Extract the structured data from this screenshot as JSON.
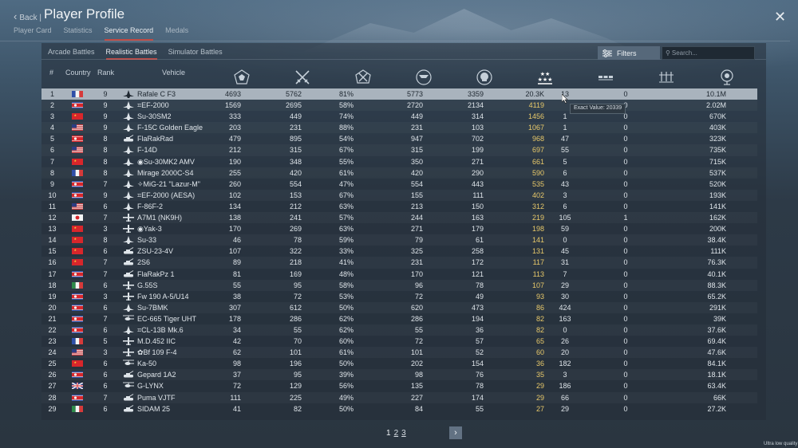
{
  "header": {
    "back_label": "Back",
    "title": "Player Profile",
    "tabs": [
      {
        "label": "Player Card",
        "active": false
      },
      {
        "label": "Statistics",
        "active": false
      },
      {
        "label": "Service Record",
        "active": true
      },
      {
        "label": "Medals",
        "active": false
      }
    ]
  },
  "subtabs": [
    {
      "label": "Arcade Battles",
      "active": false
    },
    {
      "label": "Realistic Battles",
      "active": true
    },
    {
      "label": "Simulator Battles",
      "active": false
    }
  ],
  "filters_label": "Filters",
  "search_placeholder": "Search...",
  "columns": {
    "num": "#",
    "country": "Country",
    "rank": "Rank",
    "vehicle": "Vehicle"
  },
  "stat_icons": [
    "battles-icon",
    "respawns-icon",
    "victories-icon",
    "missions-icon",
    "deaths-icon",
    "rank-stars-icon",
    "ground-kills-icon",
    "air-kills-icon",
    "score-icon"
  ],
  "colors": {
    "selected_row": "#a9b3bd",
    "highlight_value": "#e8c96a",
    "active_tab_underline": "#c14a44"
  },
  "rows": [
    {
      "n": "1",
      "country": "France",
      "rank": "9",
      "type": "jet",
      "vehicle": "Rafale C F3",
      "v": [
        "4693",
        "5762",
        "81%",
        "5773",
        "3359",
        "20.3K",
        "13",
        "0",
        "10.1M"
      ]
    },
    {
      "n": "2",
      "country": "North Korea",
      "rank": "9",
      "type": "jet",
      "vehicle": "⌗EF-2000",
      "v": [
        "1569",
        "2695",
        "58%",
        "2720",
        "2134",
        "4119",
        "",
        "0",
        "2.02M"
      ]
    },
    {
      "n": "3",
      "country": "China",
      "rank": "9",
      "type": "jet",
      "vehicle": "Su-30SM2",
      "v": [
        "333",
        "449",
        "74%",
        "449",
        "314",
        "1456",
        "1",
        "0",
        "670K"
      ]
    },
    {
      "n": "4",
      "country": "USA",
      "rank": "9",
      "type": "jet",
      "vehicle": "F-15C Golden Eagle",
      "v": [
        "203",
        "231",
        "88%",
        "231",
        "103",
        "1067",
        "1",
        "0",
        "403K"
      ]
    },
    {
      "n": "5",
      "country": "Germany",
      "rank": "8",
      "type": "spaa",
      "vehicle": "FlaRakRad",
      "v": [
        "479",
        "895",
        "54%",
        "947",
        "702",
        "968",
        "47",
        "0",
        "323K"
      ]
    },
    {
      "n": "6",
      "country": "USA",
      "rank": "8",
      "type": "jet",
      "vehicle": "F-14D",
      "v": [
        "212",
        "315",
        "67%",
        "315",
        "199",
        "697",
        "55",
        "0",
        "735K"
      ]
    },
    {
      "n": "7",
      "country": "China",
      "rank": "8",
      "type": "jet",
      "vehicle": "◉Su-30MK2 AMV",
      "v": [
        "190",
        "348",
        "55%",
        "350",
        "271",
        "661",
        "5",
        "0",
        "715K"
      ]
    },
    {
      "n": "8",
      "country": "France",
      "rank": "8",
      "type": "jet",
      "vehicle": "Mirage 2000C-S4",
      "v": [
        "255",
        "420",
        "61%",
        "420",
        "290",
        "590",
        "6",
        "0",
        "537K"
      ]
    },
    {
      "n": "9",
      "country": "North Korea",
      "rank": "7",
      "type": "jet",
      "vehicle": "✧MiG-21 \"Lazur-M\"",
      "v": [
        "260",
        "554",
        "47%",
        "554",
        "443",
        "535",
        "43",
        "0",
        "520K"
      ]
    },
    {
      "n": "10",
      "country": "North Korea",
      "rank": "9",
      "type": "jet",
      "vehicle": "⌗EF-2000 (AESA)",
      "v": [
        "102",
        "153",
        "67%",
        "155",
        "111",
        "402",
        "3",
        "0",
        "193K"
      ]
    },
    {
      "n": "11",
      "country": "USA",
      "rank": "6",
      "type": "jet",
      "vehicle": "F-86F-2",
      "v": [
        "134",
        "212",
        "63%",
        "213",
        "150",
        "312",
        "6",
        "0",
        "141K"
      ]
    },
    {
      "n": "12",
      "country": "Japan",
      "rank": "7",
      "type": "plane",
      "vehicle": "A7M1 (NK9H)",
      "v": [
        "138",
        "241",
        "57%",
        "244",
        "163",
        "219",
        "105",
        "1",
        "162K"
      ]
    },
    {
      "n": "13",
      "country": "China",
      "rank": "3",
      "type": "plane",
      "vehicle": "◉Yak-3",
      "v": [
        "170",
        "269",
        "63%",
        "271",
        "179",
        "198",
        "59",
        "0",
        "200K"
      ]
    },
    {
      "n": "14",
      "country": "China",
      "rank": "8",
      "type": "jet",
      "vehicle": "Su-33",
      "v": [
        "46",
        "78",
        "59%",
        "79",
        "61",
        "141",
        "0",
        "0",
        "38.4K"
      ]
    },
    {
      "n": "15",
      "country": "China",
      "rank": "6",
      "type": "spaa",
      "vehicle": "ZSU-23-4V",
      "v": [
        "107",
        "322",
        "33%",
        "325",
        "258",
        "131",
        "45",
        "0",
        "111K"
      ]
    },
    {
      "n": "16",
      "country": "China",
      "rank": "7",
      "type": "spaa",
      "vehicle": "2S6",
      "v": [
        "89",
        "218",
        "41%",
        "231",
        "172",
        "117",
        "31",
        "0",
        "76.3K"
      ]
    },
    {
      "n": "17",
      "country": "North Korea",
      "rank": "7",
      "type": "spaa",
      "vehicle": "FlaRakPz 1",
      "v": [
        "81",
        "169",
        "48%",
        "170",
        "121",
        "113",
        "7",
        "0",
        "40.1K"
      ]
    },
    {
      "n": "18",
      "country": "Italy",
      "rank": "6",
      "type": "plane",
      "vehicle": "G.55S",
      "v": [
        "55",
        "95",
        "58%",
        "96",
        "78",
        "107",
        "29",
        "0",
        "88.3K"
      ]
    },
    {
      "n": "19",
      "country": "North Korea",
      "rank": "3",
      "type": "plane",
      "vehicle": "Fw 190 A-5/U14",
      "v": [
        "38",
        "72",
        "53%",
        "72",
        "49",
        "93",
        "30",
        "0",
        "65.2K"
      ]
    },
    {
      "n": "20",
      "country": "North Korea",
      "rank": "6",
      "type": "jet",
      "vehicle": "Su-7BMK",
      "v": [
        "307",
        "612",
        "50%",
        "620",
        "473",
        "86",
        "424",
        "0",
        "291K"
      ]
    },
    {
      "n": "21",
      "country": "North Korea",
      "rank": "7",
      "type": "heli",
      "vehicle": "EC-665 Tiger UHT",
      "v": [
        "178",
        "286",
        "62%",
        "286",
        "194",
        "82",
        "163",
        "0",
        "39K"
      ]
    },
    {
      "n": "22",
      "country": "North Korea",
      "rank": "6",
      "type": "jet",
      "vehicle": "⌗CL-13B Mk.6",
      "v": [
        "34",
        "55",
        "62%",
        "55",
        "36",
        "82",
        "0",
        "0",
        "37.6K"
      ]
    },
    {
      "n": "23",
      "country": "France",
      "rank": "5",
      "type": "plane",
      "vehicle": "M.D.452 IIC",
      "v": [
        "42",
        "70",
        "60%",
        "72",
        "57",
        "65",
        "26",
        "0",
        "69.4K"
      ]
    },
    {
      "n": "24",
      "country": "USA",
      "rank": "3",
      "type": "plane",
      "vehicle": "✿Bf 109 F-4",
      "v": [
        "62",
        "101",
        "61%",
        "101",
        "52",
        "60",
        "20",
        "0",
        "47.6K"
      ]
    },
    {
      "n": "25",
      "country": "China",
      "rank": "6",
      "type": "heli",
      "vehicle": "Ka-50",
      "v": [
        "98",
        "196",
        "50%",
        "202",
        "154",
        "36",
        "182",
        "0",
        "84.1K"
      ]
    },
    {
      "n": "26",
      "country": "North Korea",
      "rank": "6",
      "type": "spaa",
      "vehicle": "Gepard 1A2",
      "v": [
        "37",
        "95",
        "39%",
        "98",
        "76",
        "35",
        "3",
        "0",
        "18.1K"
      ]
    },
    {
      "n": "27",
      "country": "UK",
      "rank": "6",
      "type": "heli",
      "vehicle": "G-LYNX",
      "v": [
        "72",
        "129",
        "56%",
        "135",
        "78",
        "29",
        "186",
        "0",
        "63.4K"
      ]
    },
    {
      "n": "28",
      "country": "North Korea",
      "rank": "7",
      "type": "spaa",
      "vehicle": "Puma VJTF",
      "v": [
        "111",
        "225",
        "49%",
        "227",
        "174",
        "29",
        "66",
        "0",
        "66K"
      ]
    },
    {
      "n": "29",
      "country": "Italy",
      "rank": "6",
      "type": "spaa",
      "vehicle": "SIDAM 25",
      "v": [
        "41",
        "82",
        "50%",
        "84",
        "55",
        "27",
        "29",
        "0",
        "27.2K"
      ]
    }
  ],
  "tooltip": "Exact Value: 20339",
  "pagination": {
    "pages": [
      "1",
      "2",
      "3"
    ],
    "current": "1"
  },
  "quality_label": "Ultra low quality"
}
